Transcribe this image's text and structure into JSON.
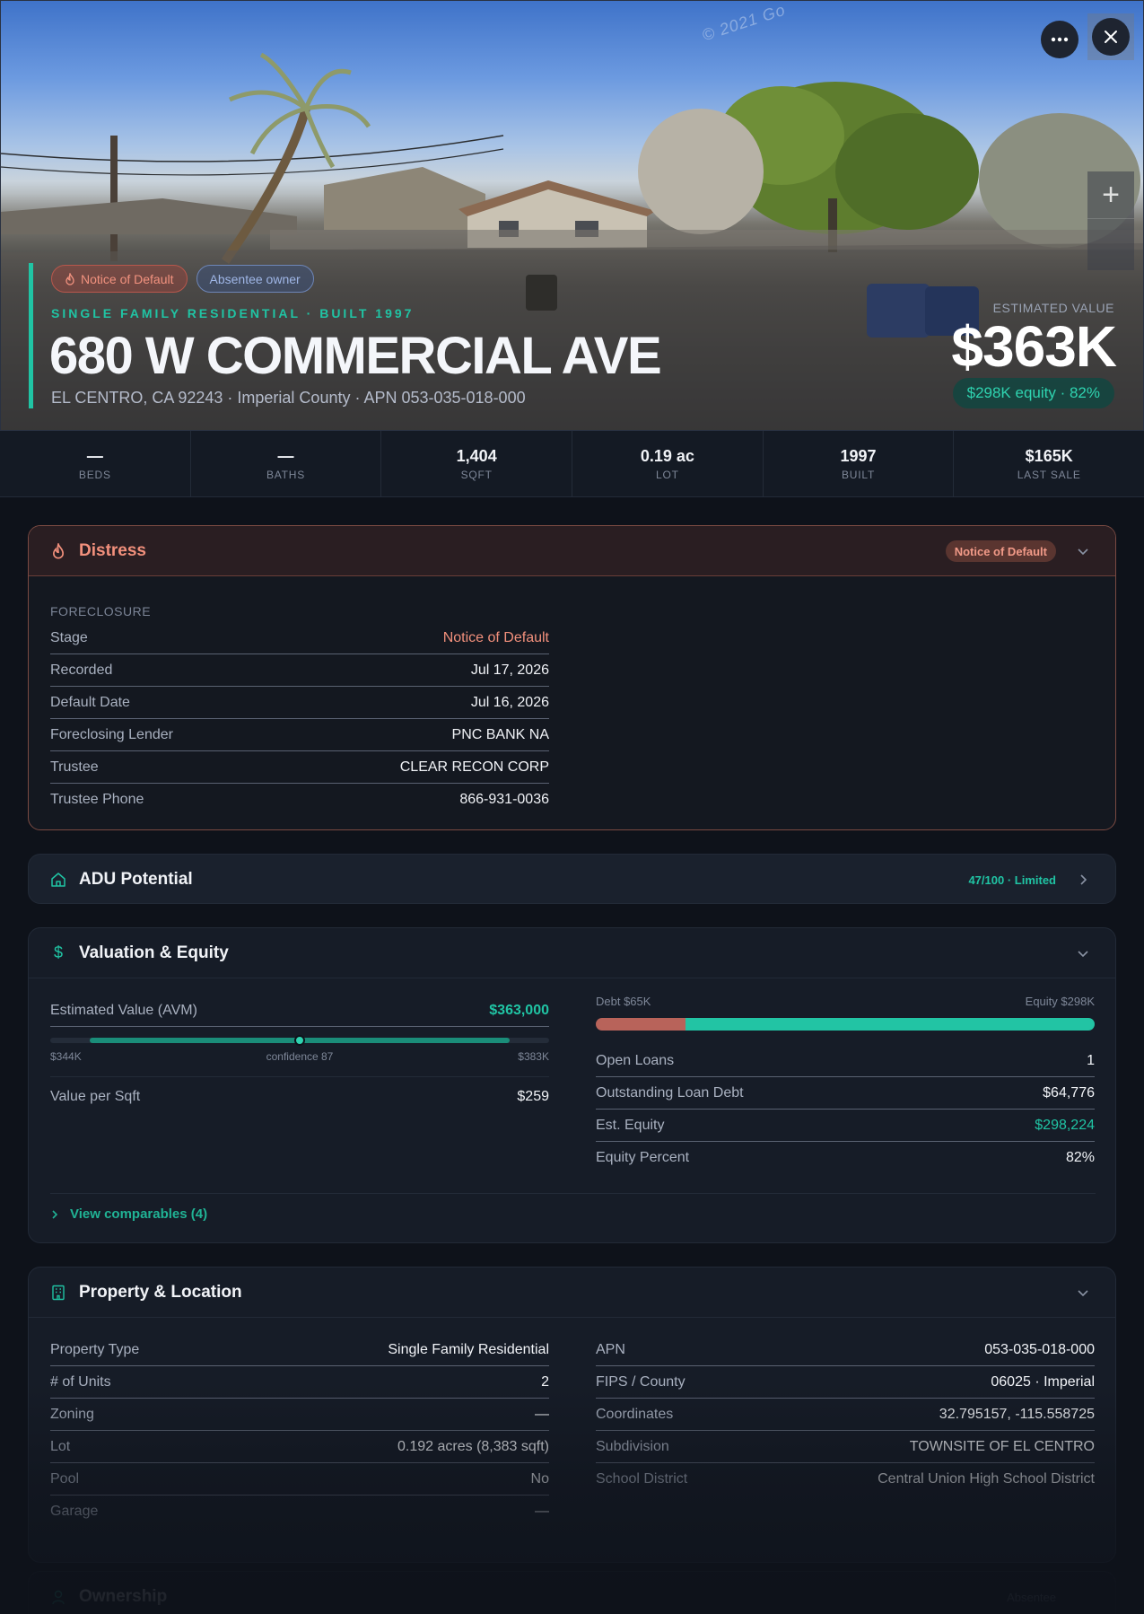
{
  "hero": {
    "watermark": "© 2021 Go",
    "badges": [
      {
        "label": "Notice of Default",
        "icon": "flame-icon"
      },
      {
        "label": "Absentee owner"
      }
    ],
    "subtitle": "SINGLE FAMILY RESIDENTIAL · BUILT 1997",
    "address": "680 W COMMERCIAL AVE",
    "location": "EL CENTRO, CA 92243 · Imperial County · APN 053-035-018-000",
    "estimated_label": "ESTIMATED VALUE",
    "estimated_value": "$363K",
    "equity_pill": "$298K equity · 82%",
    "accent_color": "#20c4a4"
  },
  "stats": [
    {
      "value": "—",
      "label": "BEDS"
    },
    {
      "value": "—",
      "label": "BATHS"
    },
    {
      "value": "1,404",
      "label": "SQFT"
    },
    {
      "value": "0.19 ac",
      "label": "LOT"
    },
    {
      "value": "1997",
      "label": "BUILT"
    },
    {
      "value": "$165K",
      "label": "LAST SALE"
    }
  ],
  "distress": {
    "title": "Distress",
    "badge": "Notice of Default",
    "section": "FORECLOSURE",
    "rows": [
      {
        "k": "Stage",
        "v": "Notice of Default"
      },
      {
        "k": "Recorded",
        "v": "Jul 17, 2026"
      },
      {
        "k": "Default Date",
        "v": "Jul 16, 2026"
      },
      {
        "k": "Foreclosing Lender",
        "v": "PNC BANK NA"
      },
      {
        "k": "Trustee",
        "v": "CLEAR RECON CORP"
      },
      {
        "k": "Trustee Phone",
        "v": "866-931-0036"
      }
    ],
    "stage_color": "#f2907c"
  },
  "adu": {
    "title": "ADU Potential",
    "score": "47/100 · Limited"
  },
  "valuation": {
    "title": "Valuation & Equity",
    "avm_label": "Estimated Value (AVM)",
    "avm_value": "$363,000",
    "range_low": "$344K",
    "range_conf": "confidence 87",
    "range_high": "$383K",
    "range_fraction_start": 0.08,
    "range_fraction_end": 0.92,
    "point_fraction": 0.5,
    "per_sqft_label": "Value per Sqft",
    "per_sqft_value": "$259",
    "debt_label": "Debt $65K",
    "equity_label": "Equity $298K",
    "debt_fraction": 0.18,
    "rows": [
      {
        "k": "Open Loans",
        "v": "1"
      },
      {
        "k": "Outstanding Loan Debt",
        "v": "$64,776"
      },
      {
        "k": "Est. Equity",
        "v": "$298,224"
      },
      {
        "k": "Equity Percent",
        "v": "82%"
      }
    ],
    "comparables": "View comparables (4)"
  },
  "property": {
    "title": "Property & Location",
    "left": [
      {
        "k": "Property Type",
        "v": "Single Family Residential"
      },
      {
        "k": "# of Units",
        "v": "2"
      },
      {
        "k": "Zoning",
        "v": "—"
      },
      {
        "k": "Lot",
        "v": "0.192 acres (8,383 sqft)"
      },
      {
        "k": "Pool",
        "v": "No"
      },
      {
        "k": "Garage",
        "v": "—"
      }
    ],
    "right": [
      {
        "k": "APN",
        "v": "053-035-018-000"
      },
      {
        "k": "FIPS / County",
        "v": "06025 · Imperial"
      },
      {
        "k": "Coordinates",
        "v": "32.795157, -115.558725"
      },
      {
        "k": "Subdivision",
        "v": "TOWNSITE OF EL CENTRO"
      },
      {
        "k": "School District",
        "v": "Central Union High School District"
      }
    ]
  },
  "ownership": {
    "title": "Ownership",
    "right": "Absentee"
  },
  "colors": {
    "teal": "#20c4a4",
    "salmon": "#f2907c",
    "bg": "#0e121a"
  }
}
